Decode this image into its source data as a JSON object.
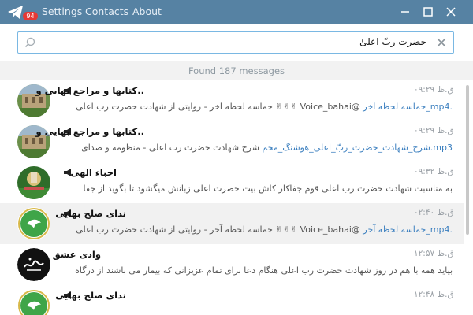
{
  "app": {
    "badge": "94",
    "menu": {
      "settings": "Settings",
      "contacts": "Contacts",
      "about": "About"
    },
    "window_controls": [
      "minimize-icon",
      "maximize-icon",
      "close-icon"
    ],
    "brand_color": "#5682a3"
  },
  "search": {
    "query": "حضرت ربّ اعلیٰ",
    "clear_icon": "close-icon",
    "search_icon": "search-icon"
  },
  "found_label": "Found 187 messages",
  "results": [
    {
      "title": "..کتابها و مراجع بهایی و",
      "time": "ق.ظ ۰۹:۲۹",
      "snippet_text": "@Voice_bahai ✌✌✌ حماسه لحظه آخر - روایتی از شهادت حضرت رب اعلی",
      "snippet_link": ".mp4_حماسه لحظه آخر",
      "avatar": "building-photo",
      "channel_icon": "megaphone-icon"
    },
    {
      "title": "..کتابها و مراجع بهایی و",
      "time": "ق.ظ ۰۹:۲۹",
      "snippet_text": "شرح شهادت حضرت رب اعلی - منظومه و صدای",
      "snippet_link": "mp3.شرح_شهادت_حضرت_ربّ_اعلی_هوشنگ_محم",
      "avatar": "building-photo",
      "channel_icon": "megaphone-icon"
    },
    {
      "title": "احباء الهی",
      "time": "ق.ظ ۰۹:۳۲",
      "snippet_text": "به مناسبت شهادت حضرت رب اعلی  قوم جفاکار  کاش بیت حضرت اعلی زبانش میگشود تا بگوید از جفا",
      "snippet_link": "",
      "avatar": "garden-photo",
      "channel_icon": "megaphone-icon"
    },
    {
      "title": "ندای صلح بهایی",
      "time": "ق.ظ ۰۲:۴۰",
      "snippet_text": "@Voice_bahai ✌✌✌ حماسه لحظه آخر - روایتی از شهادت حضرت رب اعلی",
      "snippet_link": ".mp4_حماسه لحظه آخر",
      "avatar": "green-dove-logo",
      "channel_icon": "megaphone-icon",
      "active": true
    },
    {
      "title": "وادی عشق",
      "time": "ق.ظ ۱۲:۵۷",
      "snippet_text": "بیاید همه با هم در روز شهادت حضرت رب اعلی هنگام دعا برای تمام عزیزانی که بیمار می باشند از درگاه",
      "snippet_link": "",
      "avatar": "calligraphy-logo",
      "channel_icon": "megaphone-icon"
    },
    {
      "title": "ندای صلح بهایی",
      "time": "ق.ظ ۱۲:۴۸",
      "snippet_text": "",
      "snippet_link": "",
      "avatar": "green-dove-logo",
      "channel_icon": "megaphone-icon"
    }
  ]
}
